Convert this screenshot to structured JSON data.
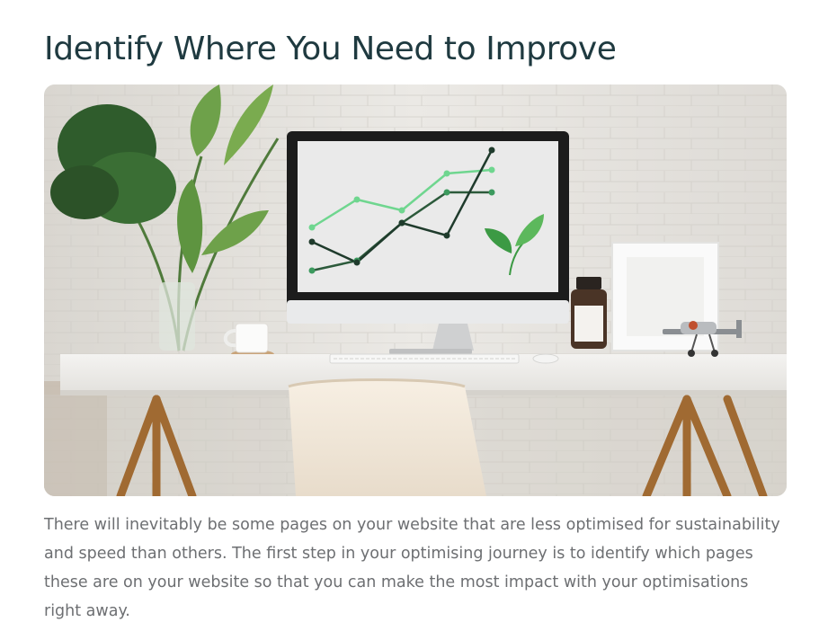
{
  "article": {
    "heading": "Identify Where You Need to Improve",
    "paragraph": "There will inevitably be some pages on your website that are less optimised for sustainability and speed than others. The first step in your optimising journey is to identify which pages these are on your website so that you can make the most impact with your optimisations right away."
  },
  "hero_image": {
    "description_icon": "desk-workspace-illustration",
    "colors": {
      "wall": "#e5e3df",
      "desk": "#f1f0ee",
      "monitor_bezel": "#1c1c1c",
      "chart_light": "#6fd68f",
      "chart_mid": "#3c9a5e",
      "chart_dark": "#1f3b2c",
      "leaf": "#3c9a44"
    }
  }
}
